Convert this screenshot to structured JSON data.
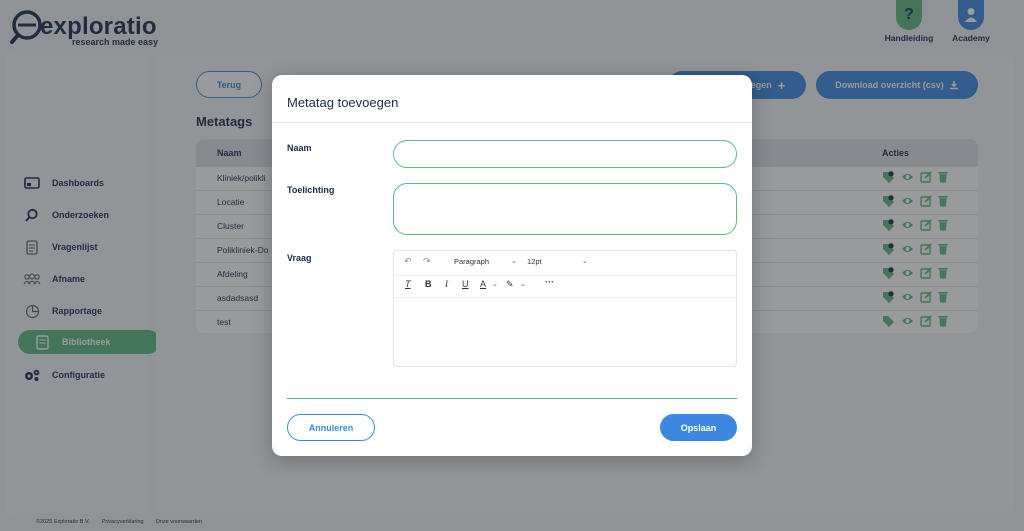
{
  "brand": {
    "name": "exploratio",
    "tagline": "research made easy"
  },
  "header": {
    "help": {
      "label": "Handleiding",
      "icon": "question-icon",
      "color": "#5cba7d"
    },
    "academy": {
      "label": "Academy",
      "icon": "user-icon",
      "color": "#3c88e0"
    }
  },
  "sidebar": {
    "items": [
      {
        "label": "Dashboards",
        "icon": "dashboard-icon"
      },
      {
        "label": "Onderzoeken",
        "icon": "search-icon"
      },
      {
        "label": "Vragenlijst",
        "icon": "document-icon"
      },
      {
        "label": "Afname",
        "icon": "users-icon"
      },
      {
        "label": "Rapportage",
        "icon": "pie-chart-icon"
      },
      {
        "label": "Bibliotheek",
        "icon": "book-icon",
        "active": true
      },
      {
        "label": "Configuratie",
        "icon": "gears-icon"
      }
    ]
  },
  "main": {
    "back_label": "Terug",
    "add_label": "egen",
    "download_label": "Download overzicht (csv)",
    "section_title": "Metatags",
    "columns": {
      "name": "Naam",
      "actions": "Acties"
    },
    "rows": [
      {
        "name": "Kliniek/polikli",
        "badge": "1"
      },
      {
        "name": "Locatie",
        "badge": "2"
      },
      {
        "name": "Cluster",
        "badge": "1"
      },
      {
        "name": "Polikliniek-Do",
        "badge": "5"
      },
      {
        "name": "Afdeling",
        "badge": "1"
      },
      {
        "name": "asdadsasd",
        "badge": "1"
      },
      {
        "name": "test",
        "badge": ""
      }
    ]
  },
  "footer": {
    "copyright": "©2025 Exploratio B.V.",
    "privacy": "Privacyverklaring",
    "terms": "Onze voorwaarden"
  },
  "modal": {
    "title": "Metatag toevoegen",
    "fields": {
      "name_label": "Naam",
      "description_label": "Toelichting",
      "question_label": "Vraag"
    },
    "editor": {
      "block_format": "Paragraph",
      "font_size": "12pt"
    },
    "cancel_label": "Annuleren",
    "save_label": "Opslaan"
  },
  "colors": {
    "primary": "#3c88e0",
    "accent": "#5cba7d",
    "text": "#1b2b4b"
  }
}
